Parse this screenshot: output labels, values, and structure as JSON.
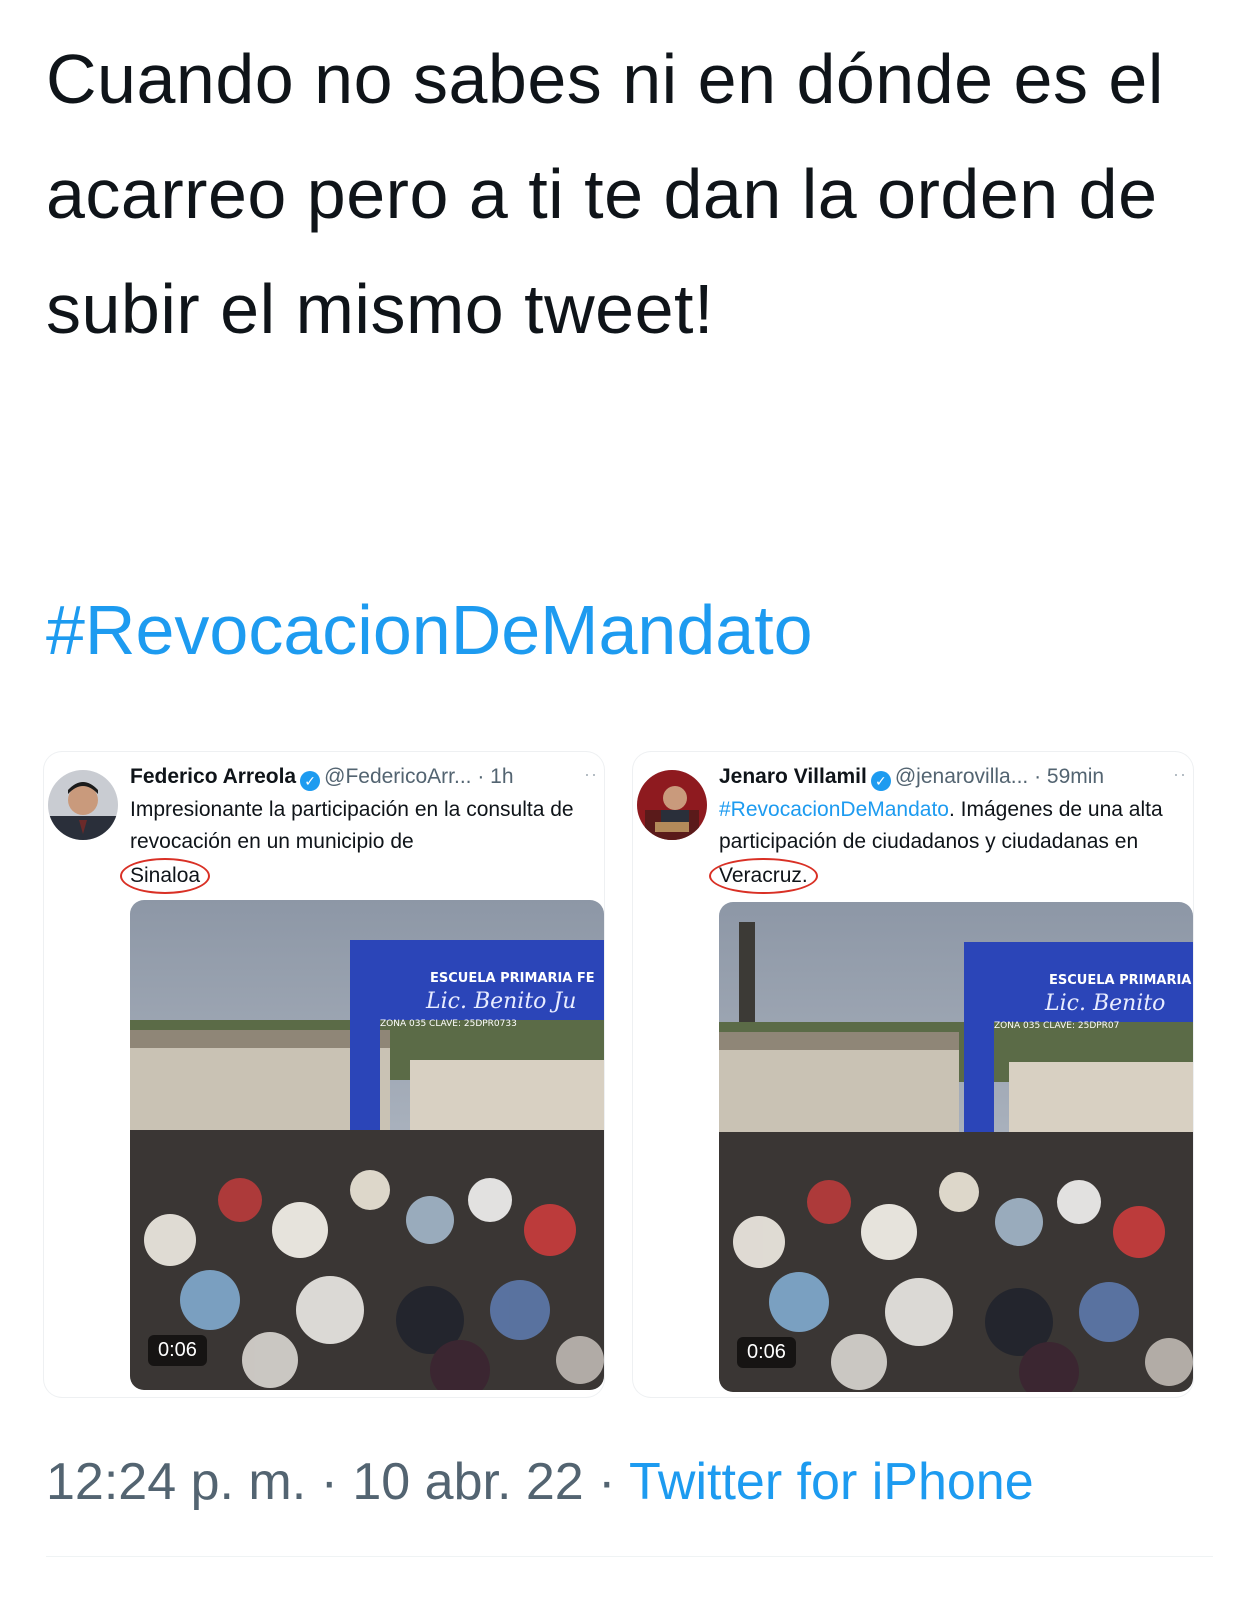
{
  "tweet": {
    "text": "Cuando no sabes ni en dónde es el acarreo pero a ti te dan la orden de subir el mismo tweet!",
    "hashtag": "#RevocacionDeMandato"
  },
  "embedded": [
    {
      "name": "Federico Arreola",
      "handle": "@FedericoArr...",
      "time": "· 1h",
      "text_before": "Impresionante la participación en la consulta de revocación en un municipio de",
      "highlight": "Sinaloa",
      "text_after": "",
      "duration": "0:06",
      "sign_line1": "ESCUELA PRIMARIA FE",
      "sign_line2": "Lic. Benito Ju",
      "sign_line3": "ZONA 035  CLAVE: 25DPR0733"
    },
    {
      "name": "Jenaro Villamil",
      "handle": "@jenarovilla...",
      "time": "· 59min",
      "hashtag": "#RevocacionDeMandato",
      "text_before": ". Imágenes de una alta participación de ciudadanos y ciudadanas en",
      "highlight": "Veracruz.",
      "duration": "0:06",
      "sign_line1": "ESCUELA PRIMARIA",
      "sign_line2": "Lic. Benito",
      "sign_line3": "ZONA 035  CLAVE: 25DPR07"
    }
  ],
  "footer": {
    "time": "12:24 p. m.",
    "date": "10 abr. 22",
    "source": "Twitter for iPhone"
  },
  "colors": {
    "link": "#1d9bf0",
    "highlight_circle": "#d93025",
    "sign_blue": "#2b45b8"
  }
}
